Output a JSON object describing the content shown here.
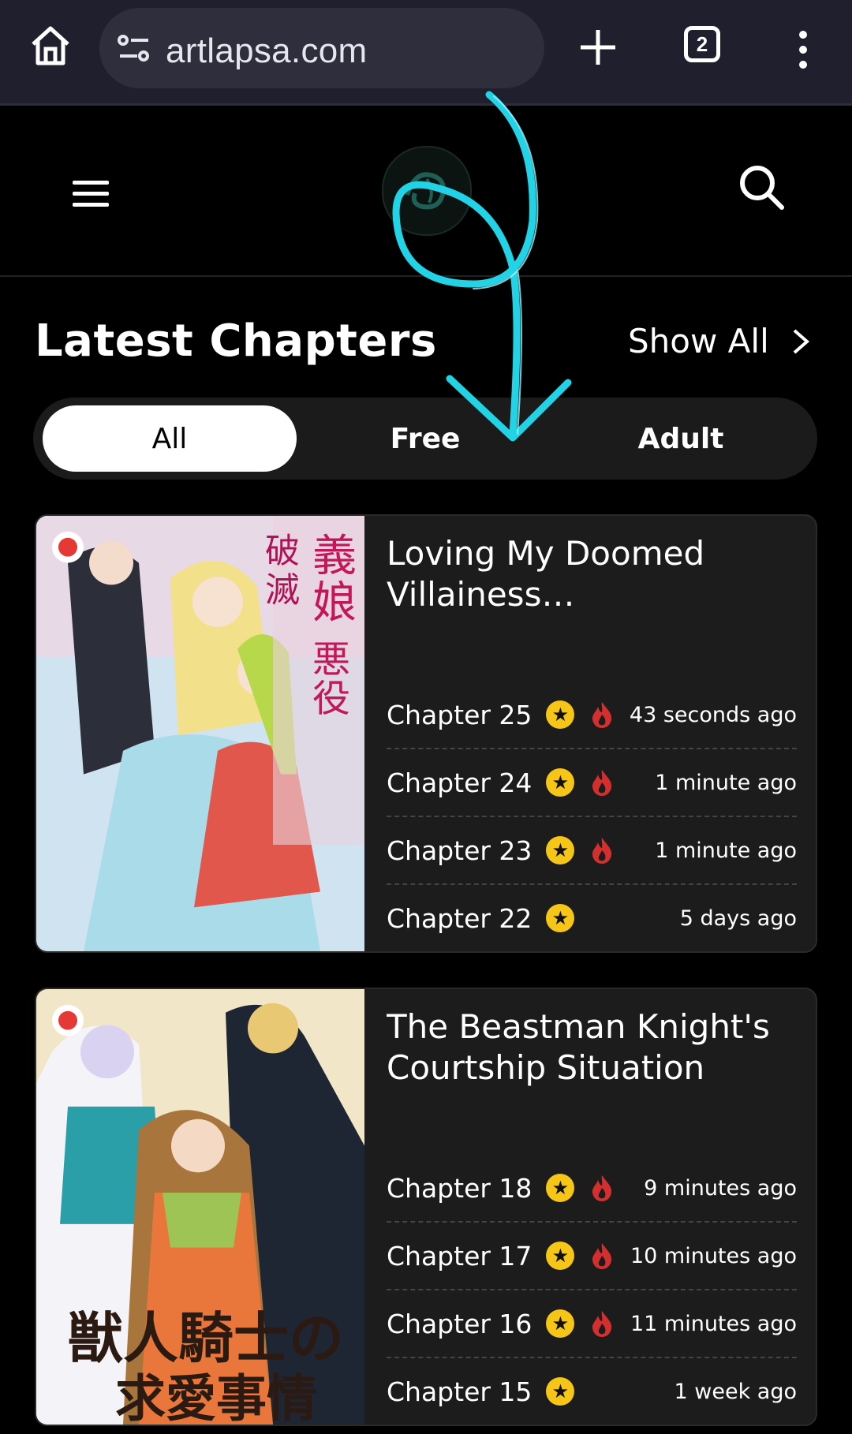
{
  "browser": {
    "url": "artlapsa.com",
    "tab_count": "2"
  },
  "section": {
    "title": "Latest Chapters",
    "show_all": "Show All"
  },
  "filters": [
    {
      "label": "All",
      "active": true
    },
    {
      "label": "Free",
      "active": false
    },
    {
      "label": "Adult",
      "active": false
    }
  ],
  "cards": [
    {
      "title": "Loving My Doomed Villainess Stepdaughte…",
      "chapters": [
        {
          "label": "Chapter 25",
          "time": "43 seconds ago",
          "star": true,
          "hot": true
        },
        {
          "label": "Chapter 24",
          "time": "1 minute ago",
          "star": true,
          "hot": true
        },
        {
          "label": "Chapter 23",
          "time": "1 minute ago",
          "star": true,
          "hot": true
        },
        {
          "label": "Chapter 22",
          "time": "5 days ago",
          "star": true,
          "hot": false
        }
      ]
    },
    {
      "title": "The Beastman Knight's Courtship Situation",
      "chapters": [
        {
          "label": "Chapter 18",
          "time": "9 minutes ago",
          "star": true,
          "hot": true
        },
        {
          "label": "Chapter 17",
          "time": "10 minutes ago",
          "star": true,
          "hot": true
        },
        {
          "label": "Chapter 16",
          "time": "11 minutes ago",
          "star": true,
          "hot": true
        },
        {
          "label": "Chapter 15",
          "time": "1 week ago",
          "star": true,
          "hot": false
        }
      ]
    }
  ],
  "colors": {
    "accent_star": "#f5c518",
    "hot_red": "#d32f2f",
    "annotation_cyan": "#22d3e6"
  }
}
